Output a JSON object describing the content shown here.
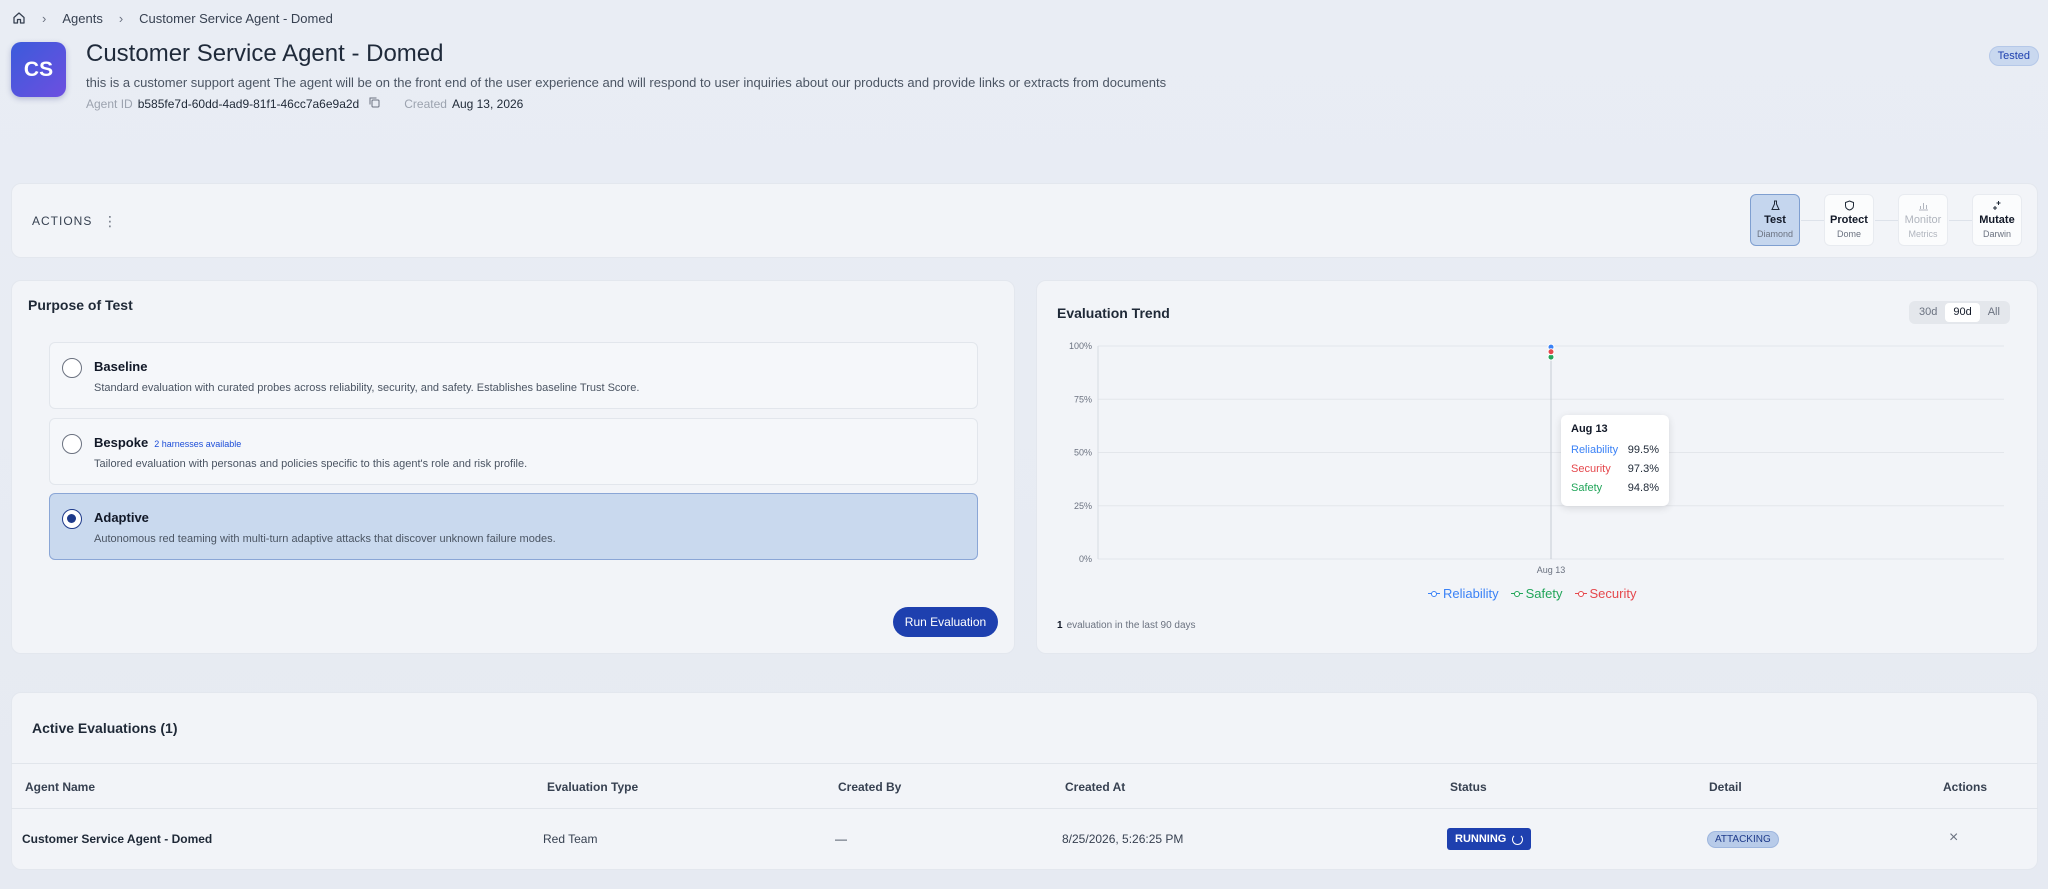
{
  "breadcrumb": {
    "items": [
      "Agents",
      "Customer Service Agent - Domed"
    ]
  },
  "agent": {
    "initials": "CS",
    "name": "Customer Service Agent - Domed",
    "description": "this is a customer support agent The agent will be on the front end of the user experience and will respond to user inquiries about our products and provide links or extracts from documents",
    "id_label": "Agent ID",
    "id": "b585fe7d-60dd-4ad9-81f1-46cc7a6e9a2d",
    "created_label": "Created",
    "created": "Aug 13, 2026",
    "badge": "Tested"
  },
  "actions": {
    "label": "ACTIONS",
    "buttons": [
      {
        "label": "Test",
        "sub": "Diamond",
        "icon": "flask-icon"
      },
      {
        "label": "Protect",
        "sub": "Dome",
        "icon": "shield-icon"
      },
      {
        "label": "Monitor",
        "sub": "Metrics",
        "icon": "bar-chart-icon"
      },
      {
        "label": "Mutate",
        "sub": "Darwin",
        "icon": "sparkle-icon"
      }
    ]
  },
  "purpose": {
    "title": "Purpose of Test",
    "options": [
      {
        "title": "Baseline",
        "badge": "",
        "desc": "Standard evaluation with curated probes across reliability, security, and safety. Establishes baseline Trust Score."
      },
      {
        "title": "Bespoke",
        "badge": "2 harnesses available",
        "desc": "Tailored evaluation with personas and policies specific to this agent's role and risk profile."
      },
      {
        "title": "Adaptive",
        "badge": "",
        "desc": "Autonomous red teaming with multi-turn adaptive attacks that discover unknown failure modes."
      }
    ],
    "selected": "Adaptive",
    "run_label": "Run Evaluation"
  },
  "trend": {
    "title": "Evaluation Trend",
    "ranges": [
      "30d",
      "90d",
      "All"
    ],
    "active_range": "90d",
    "count": "1",
    "count_text": "evaluation in the last 90 days",
    "tooltip": {
      "date": "Aug 13",
      "rows": [
        {
          "name": "Reliability",
          "value": "99.5%"
        },
        {
          "name": "Security",
          "value": "97.3%"
        },
        {
          "name": "Safety",
          "value": "94.8%"
        }
      ]
    },
    "colors": {
      "Reliability": "#3b82f6",
      "Safety": "#22a55a",
      "Security": "#e5484d"
    }
  },
  "chart_data": {
    "type": "line",
    "x": [
      "Aug 13"
    ],
    "series": [
      {
        "name": "Reliability",
        "values": [
          99.5
        ]
      },
      {
        "name": "Safety",
        "values": [
          94.8
        ]
      },
      {
        "name": "Security",
        "values": [
          97.3
        ]
      }
    ],
    "yticks": [
      "0%",
      "25%",
      "50%",
      "75%",
      "100%"
    ],
    "ylim": [
      0,
      100
    ],
    "grid": true,
    "legend": "bottom"
  },
  "evaluations": {
    "title": "Active Evaluations (1)",
    "columns": [
      "Agent Name",
      "Evaluation Type",
      "Created By",
      "Created At",
      "Status",
      "Detail",
      "Actions"
    ],
    "rows": [
      {
        "agent": "Customer Service Agent - Domed",
        "type": "Red Team",
        "created_by": "—",
        "created_at": "8/25/2026, 5:26:25 PM",
        "status": "RUNNING",
        "detail": "ATTACKING"
      }
    ]
  }
}
